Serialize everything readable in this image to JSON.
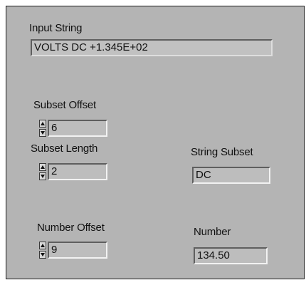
{
  "input_string": {
    "label": "Input String",
    "value": "VOLTS DC +1.345E+02"
  },
  "subset_offset": {
    "label": "Subset Offset",
    "value": "6"
  },
  "subset_length": {
    "label": "Subset Length",
    "value": "2"
  },
  "string_subset": {
    "label": "String Subset",
    "value": "DC"
  },
  "number_offset": {
    "label": "Number Offset",
    "value": "9"
  },
  "number": {
    "label": "Number",
    "value": "134.50"
  }
}
